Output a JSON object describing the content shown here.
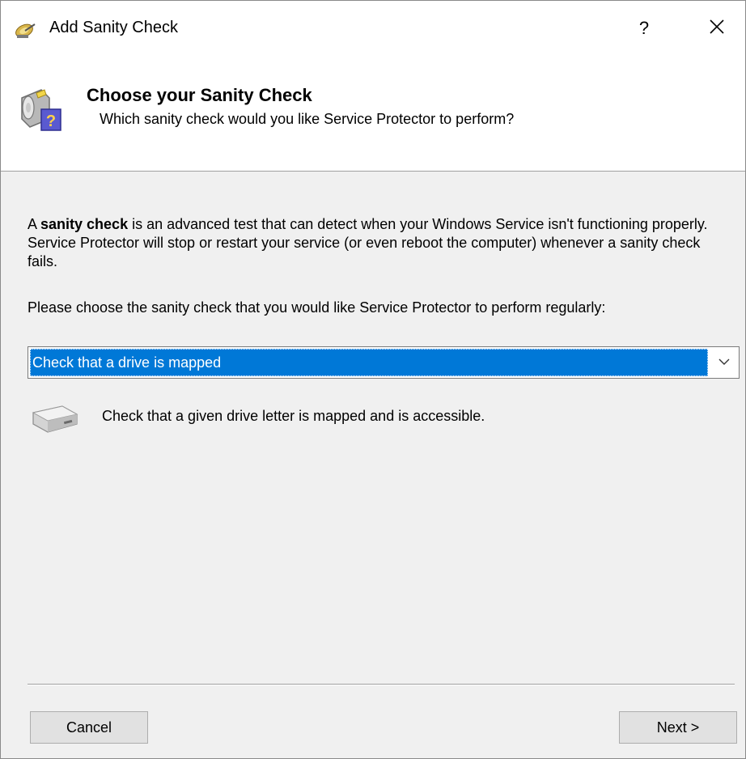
{
  "window": {
    "title": "Add Sanity Check",
    "help_label": "?",
    "title_icon": "satellite-dish-icon",
    "close_icon": "close-icon"
  },
  "header": {
    "title": "Choose your Sanity Check",
    "subtitle": "Which sanity check would you like Service Protector to perform?",
    "icon": "sanity-check-question-icon"
  },
  "intro": {
    "prefix": "A ",
    "bold": "sanity check",
    "rest": " is an advanced test that can detect when your Windows Service isn't functioning properly. Service Protector will stop or restart your service (or even reboot the computer) whenever a sanity check fails."
  },
  "prompt": "Please choose the sanity check that you would like Service Protector to perform regularly:",
  "combo": {
    "selected": "Check that a drive is mapped",
    "arrow_icon": "chevron-down-icon"
  },
  "description": {
    "text": "Check that a given drive letter is mapped and is accessible.",
    "icon": "drive-icon"
  },
  "buttons": {
    "cancel": "Cancel",
    "next": "Next >"
  },
  "colors": {
    "selection": "#0078d7",
    "dialog_bg": "#f0f0f0",
    "header_bg": "#ffffff"
  }
}
